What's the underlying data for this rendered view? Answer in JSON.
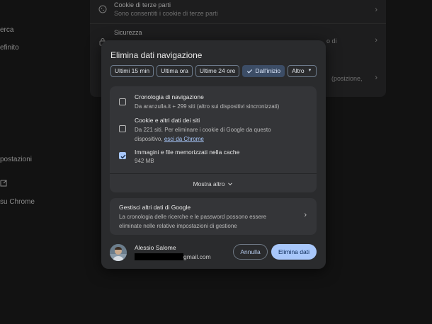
{
  "background": {
    "sidebar": [
      "erca",
      "efinito",
      "postazioni",
      "su Chrome"
    ],
    "rows": [
      {
        "title": "Cookie di terze parti",
        "desc": "Sono consentiti i cookie di terze parti"
      },
      {
        "title": "Sicurezza",
        "desc": ""
      }
    ],
    "fragments": [
      "o di",
      "(posizione,"
    ]
  },
  "dialog": {
    "title": "Elimina dati navigazione",
    "time_ranges": [
      {
        "label": "Ultimi 15 min",
        "active": false
      },
      {
        "label": "Ultima ora",
        "active": false
      },
      {
        "label": "Ultime 24 ore",
        "active": false
      },
      {
        "label": "Dall'inizio",
        "active": true
      },
      {
        "label": "Altro",
        "active": false
      }
    ],
    "items": [
      {
        "title": "Cronologia di navigazione",
        "desc": "Da aranzulla.it + 299 siti (altro sui dispositivi sincronizzati)",
        "checked": false
      },
      {
        "title": "Cookie e altri dati dei siti",
        "desc": "Da 221 siti. Per eliminare i cookie di Google da questo dispositivo,",
        "link": "esci da Chrome",
        "checked": false
      },
      {
        "title": "Immagini e file memorizzati nella cache",
        "desc": "942 MB",
        "checked": true
      }
    ],
    "show_more": "Mostra altro",
    "google_card": {
      "title": "Gestisci altri dati di Google",
      "desc": "La cronologia delle ricerche e le password possono essere eliminate nelle relative impostazioni di gestione"
    },
    "account": {
      "name": "Alessio Salome",
      "email_suffix": "gmail.com"
    },
    "cancel_label": "Annulla",
    "delete_label": "Elimina dati"
  },
  "colors": {
    "accent": "#a8c7fa",
    "dialog_bg": "#2a2b2d",
    "panel_bg": "#343538",
    "page_bg": "#121212"
  }
}
